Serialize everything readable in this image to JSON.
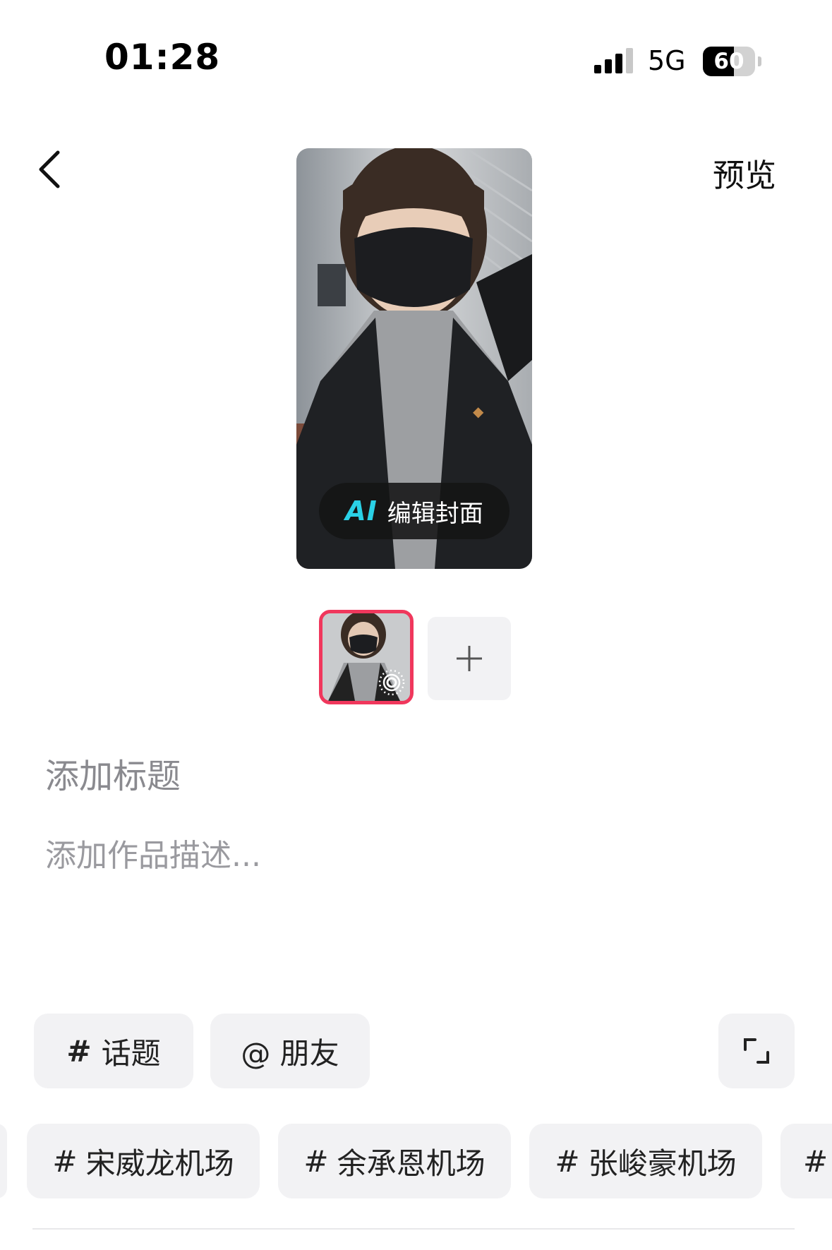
{
  "status_bar": {
    "time": "01:28",
    "network": "5G",
    "battery": "60",
    "battery_level": 0.6
  },
  "nav": {
    "back_icon": "chevron-left-icon",
    "preview_label": "预览"
  },
  "cover": {
    "ai_badge": "AI",
    "ai_label": "编辑封面"
  },
  "thumbnails": {
    "selected_badge_icon": "live-photo-icon",
    "add_icon": "plus-icon"
  },
  "form": {
    "title_placeholder": "添加标题",
    "description_placeholder": "添加作品描述..."
  },
  "chips": {
    "topic": {
      "hash": "#",
      "label": "话题"
    },
    "friend": {
      "label": "@ 朋友"
    },
    "expand_icon": "expand-corners-icon"
  },
  "suggestions": [
    {
      "hash": "#",
      "label": "宋威龙机场"
    },
    {
      "hash": "#",
      "label": "余承恩机场"
    },
    {
      "hash": "#",
      "label": "张峻豪机场"
    },
    {
      "hash": "#",
      "label": ""
    }
  ],
  "colors": {
    "accent_border": "#f0375c",
    "ai_cyan": "#2ad1e6",
    "chip_bg": "#f2f2f4"
  }
}
